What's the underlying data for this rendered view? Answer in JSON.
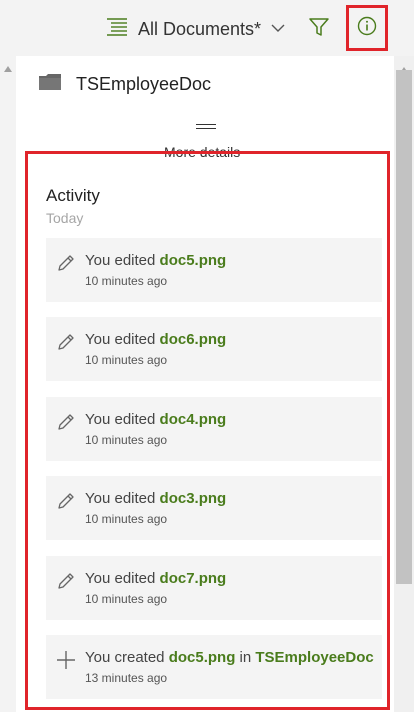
{
  "toolbar": {
    "view_label": "All Documents*",
    "view_icon": "list-view-icon",
    "filter_icon": "filter-icon",
    "info_icon": "info-icon"
  },
  "panel": {
    "doc_name": "TSEmployeeDoc",
    "doc_icon": "folder-icon",
    "more_details": "More details",
    "activity_title": "Activity",
    "activity_day": "Today",
    "activities": [
      {
        "icon": "edit-pencil-icon",
        "verb": "You edited ",
        "file": "doc5.png",
        "in_text": "",
        "location": "",
        "time": "10 minutes ago"
      },
      {
        "icon": "edit-pencil-icon",
        "verb": "You edited ",
        "file": "doc6.png",
        "in_text": "",
        "location": "",
        "time": "10 minutes ago"
      },
      {
        "icon": "edit-pencil-icon",
        "verb": "You edited ",
        "file": "doc4.png",
        "in_text": "",
        "location": "",
        "time": "10 minutes ago"
      },
      {
        "icon": "edit-pencil-icon",
        "verb": "You edited ",
        "file": "doc3.png",
        "in_text": "",
        "location": "",
        "time": "10 minutes ago"
      },
      {
        "icon": "edit-pencil-icon",
        "verb": "You edited ",
        "file": "doc7.png",
        "in_text": "",
        "location": "",
        "time": "10 minutes ago"
      },
      {
        "icon": "add-plus-icon",
        "verb": "You created ",
        "file": "doc5.png",
        "in_text": " in ",
        "location": "TSEmployeeDoc",
        "time": "13 minutes ago"
      }
    ]
  },
  "colors": {
    "accent_green": "#4a7c1c",
    "highlight_red": "#e0242a"
  }
}
